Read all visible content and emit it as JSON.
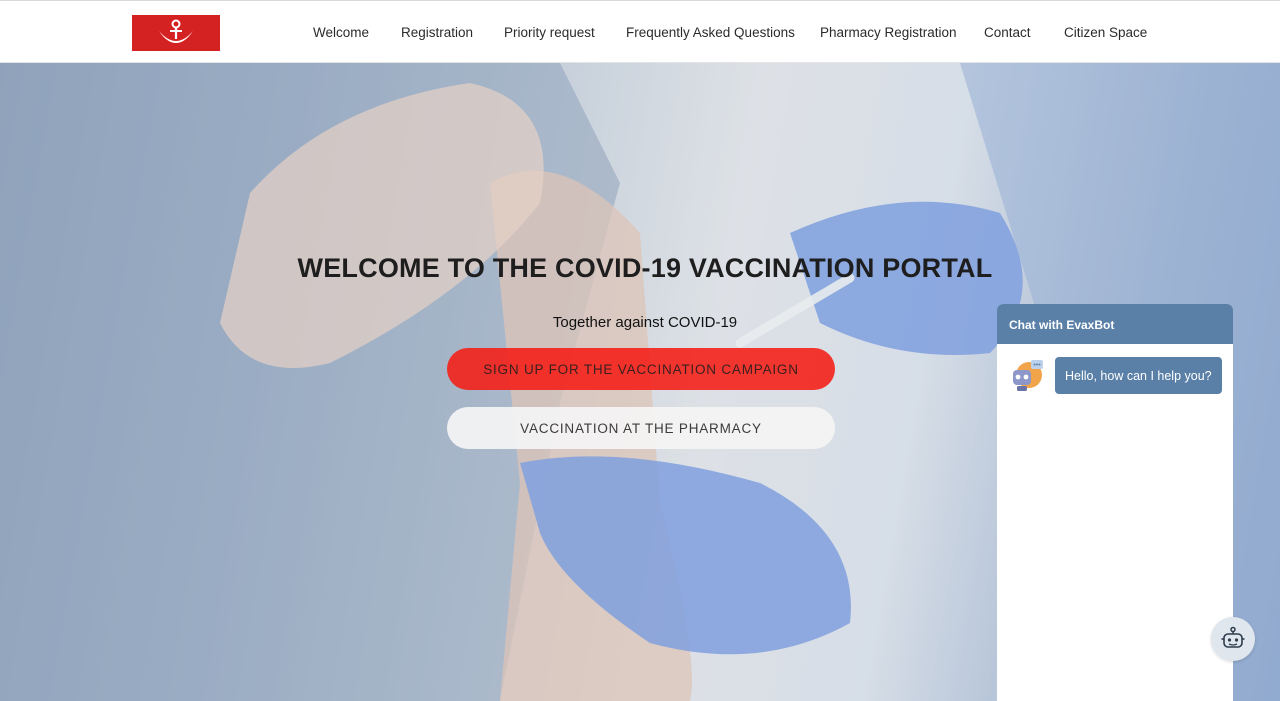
{
  "brand": {
    "logo_icon": "anchor-crescent-icon",
    "color": "#d42222"
  },
  "nav": {
    "items": [
      {
        "label": "Welcome"
      },
      {
        "label": "Registration"
      },
      {
        "label": "Priority request"
      },
      {
        "label": "Frequently Asked Questions"
      },
      {
        "label": "Pharmacy Registration"
      },
      {
        "label": "Contact"
      },
      {
        "label": "Citizen Space"
      }
    ]
  },
  "hero": {
    "title": "WELCOME TO THE COVID-19 VACCINATION PORTAL",
    "subtitle": "Together against COVID-19",
    "primary_button": "SIGN UP FOR THE VACCINATION CAMPAIGN",
    "secondary_button": "VACCINATION AT THE PHARMACY",
    "primary_color": "#f51c14"
  },
  "chat": {
    "title": "Chat with EvaxBot",
    "greeting": "Hello, how can I help you?",
    "avatar_icon": "robot-icon",
    "fab_icon": "robot-icon",
    "accent_color": "#5a80a8"
  }
}
